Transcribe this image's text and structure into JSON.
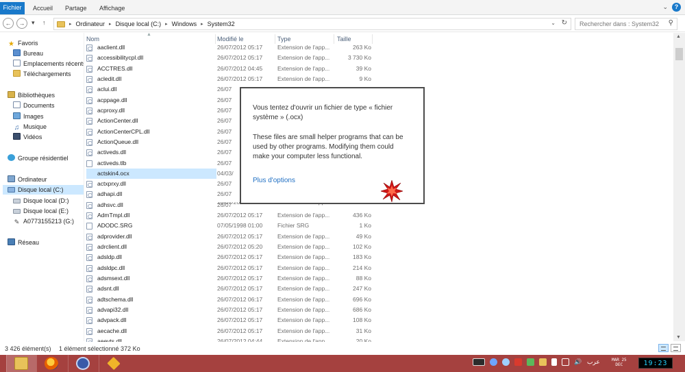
{
  "ribbon": {
    "tabs": [
      {
        "label": "Fichier"
      },
      {
        "label": "Accueil"
      },
      {
        "label": "Partage"
      },
      {
        "label": "Affichage"
      }
    ],
    "help_glyph": "?",
    "collapse_glyph": "⌄"
  },
  "address_bar": {
    "breadcrumbs": [
      "Ordinateur",
      "Disque local (C:)",
      "Windows",
      "System32"
    ],
    "search_placeholder": "Rechercher dans : System32"
  },
  "nav_pane": {
    "items": [
      {
        "label": "Favoris",
        "icon": "star-icon"
      },
      {
        "label": "Bureau",
        "icon": "desktop-folder-icon"
      },
      {
        "label": "Emplacements récents",
        "icon": "recent-places-icon"
      },
      {
        "label": "Téléchargements",
        "icon": "downloads-icon"
      },
      {
        "label": "Bibliothèques",
        "icon": "libraries-icon"
      },
      {
        "label": "Documents",
        "icon": "documents-icon"
      },
      {
        "label": "Images",
        "icon": "pictures-icon"
      },
      {
        "label": "Musique",
        "icon": "music-icon"
      },
      {
        "label": "Vidéos",
        "icon": "videos-icon"
      },
      {
        "label": "Groupe résidentiel",
        "icon": "homegroup-icon"
      },
      {
        "label": "Ordinateur",
        "icon": "computer-icon"
      },
      {
        "label": "Disque local (C:)",
        "icon": "drive-c-icon"
      },
      {
        "label": "Disque local (D:)",
        "icon": "drive-icon"
      },
      {
        "label": "Disque local (E:)",
        "icon": "drive-icon"
      },
      {
        "label": "A0773155213 (G:)",
        "icon": "usb-drive-icon"
      },
      {
        "label": "Réseau",
        "icon": "network-icon"
      }
    ]
  },
  "columns": {
    "name": "Nom",
    "date": "Modifié le",
    "type": "Type",
    "size": "Taille"
  },
  "files": [
    {
      "name": "aaclient.dll",
      "date": "26/07/2012 05:17",
      "type": "Extension de l'app...",
      "size": "263 Ko"
    },
    {
      "name": "accessibilitycpl.dll",
      "date": "26/07/2012 05:17",
      "type": "Extension de l'app...",
      "size": "3 730 Ko"
    },
    {
      "name": "ACCTRES.dll",
      "date": "26/07/2012 04:45",
      "type": "Extension de l'app...",
      "size": "39 Ko"
    },
    {
      "name": "acledit.dll",
      "date": "26/07/2012 05:17",
      "type": "Extension de l'app...",
      "size": "9 Ko"
    },
    {
      "name": "aclui.dll",
      "date": "26/07",
      "type": "",
      "size": ""
    },
    {
      "name": "acppage.dll",
      "date": "26/07",
      "type": "",
      "size": ""
    },
    {
      "name": "acproxy.dll",
      "date": "26/07",
      "type": "",
      "size": ""
    },
    {
      "name": "ActionCenter.dll",
      "date": "26/07",
      "type": "",
      "size": ""
    },
    {
      "name": "ActionCenterCPL.dll",
      "date": "26/07",
      "type": "",
      "size": ""
    },
    {
      "name": "ActionQueue.dll",
      "date": "26/07",
      "type": "",
      "size": ""
    },
    {
      "name": "activeds.dll",
      "date": "26/07",
      "type": "",
      "size": ""
    },
    {
      "name": "activeds.tlb",
      "date": "26/07",
      "type": "",
      "size": ""
    },
    {
      "name": "actskin4.ocx",
      "date": "04/03/",
      "type": "",
      "size": ""
    },
    {
      "name": "actxprxy.dll",
      "date": "26/07",
      "type": "",
      "size": ""
    },
    {
      "name": "adhapi.dll",
      "date": "26/07",
      "type": "",
      "size": ""
    },
    {
      "name": "adhsvc.dll",
      "date": "26/07",
      "type": "",
      "size": ""
    },
    {
      "name": "AdmTmpl.dll",
      "date": "26/07/2012 05:17",
      "type": "Extension de l'app...",
      "size": "436 Ko"
    },
    {
      "name": "ADODC.SRG",
      "date": "07/05/1998 01:00",
      "type": "Fichier SRG",
      "size": "1 Ko"
    },
    {
      "name": "adprovider.dll",
      "date": "26/07/2012 05:17",
      "type": "Extension de l'app...",
      "size": "49 Ko"
    },
    {
      "name": "adrclient.dll",
      "date": "26/07/2012 05:20",
      "type": "Extension de l'app...",
      "size": "102 Ko"
    },
    {
      "name": "adsldp.dll",
      "date": "26/07/2012 05:17",
      "type": "Extension de l'app...",
      "size": "183 Ko"
    },
    {
      "name": "adsldpc.dll",
      "date": "26/07/2012 05:17",
      "type": "Extension de l'app...",
      "size": "214 Ko"
    },
    {
      "name": "adsmsext.dll",
      "date": "26/07/2012 05:17",
      "type": "Extension de l'app...",
      "size": "88 Ko"
    },
    {
      "name": "adsnt.dll",
      "date": "26/07/2012 05:17",
      "type": "Extension de l'app...",
      "size": "247 Ko"
    },
    {
      "name": "adtschema.dll",
      "date": "26/07/2012 06:17",
      "type": "Extension de l'app...",
      "size": "696 Ko"
    },
    {
      "name": "advapi32.dll",
      "date": "26/07/2012 05:17",
      "type": "Extension de l'app...",
      "size": "686 Ko"
    },
    {
      "name": "advpack.dll",
      "date": "26/07/2012 05:17",
      "type": "Extension de l'app...",
      "size": "108 Ko"
    },
    {
      "name": "aecache.dll",
      "date": "26/07/2012 05:17",
      "type": "Extension de l'app...",
      "size": "31 Ko"
    },
    {
      "name": "aeevts.dll",
      "date": "26/07/2012 04:44",
      "type": "Extension de l'app...",
      "size": "20 Ko"
    }
  ],
  "partial_row": {
    "date": "26/07/2012 05:17",
    "type": "Extension de l'app...",
    "size": "31 Ko"
  },
  "selected_file": "actskin4.ocx",
  "status": {
    "count": "3 426 élément(s)",
    "selection": "1 élément sélectionné  372 Ko"
  },
  "popup": {
    "line1": "Vous tentez d'ouvrir un fichier de type « fichier",
    "line2": "système » (.ocx)",
    "line3": "These files are small helper programs that can be",
    "line4": "used by other programs. Modifying them could",
    "line5": "make your computer less functional.",
    "link": "Plus d'options"
  },
  "taskbar": {
    "apps": [
      "file-explorer-icon",
      "firefox-icon",
      "app-c-icon",
      "tools-icon"
    ],
    "language": "عرب",
    "date_line1": "MAR 25",
    "date_line2": "DEC",
    "clock": "19:23"
  },
  "colors": {
    "accent": "#1979ca",
    "selection": "#cce8ff",
    "taskbar": "#a5413f",
    "link": "#1f6fc3",
    "clock_text": "#22d3ff"
  }
}
